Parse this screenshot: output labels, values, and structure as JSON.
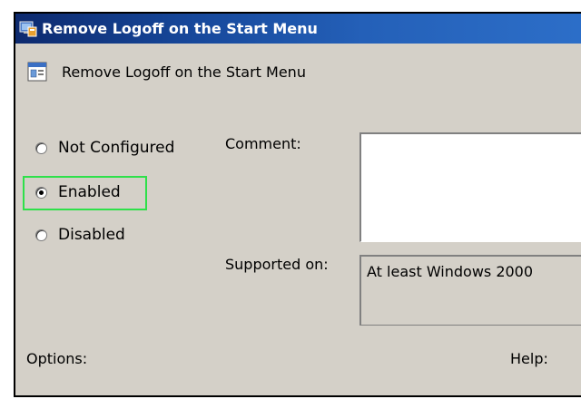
{
  "window": {
    "title": "Remove Logoff on the Start Menu",
    "icon": "group-policy-icon"
  },
  "policy": {
    "name": "Remove Logoff on the Start Menu",
    "icon": "policy-setting-icon"
  },
  "radio_options": [
    {
      "label": "Not Configured",
      "checked": false
    },
    {
      "label": "Enabled",
      "checked": true
    },
    {
      "label": "Disabled",
      "checked": false
    }
  ],
  "comment": {
    "label": "Comment:",
    "value": ""
  },
  "supported_on": {
    "label": "Supported on:",
    "value": "At least Windows 2000"
  },
  "options_label": "Options:",
  "help_label": "Help:",
  "colors": {
    "highlight": "#2ee04a",
    "title_bar_start": "#0d2a6e",
    "title_bar_end": "#2d6fc9",
    "dialog_bg": "#d4d0c8"
  }
}
